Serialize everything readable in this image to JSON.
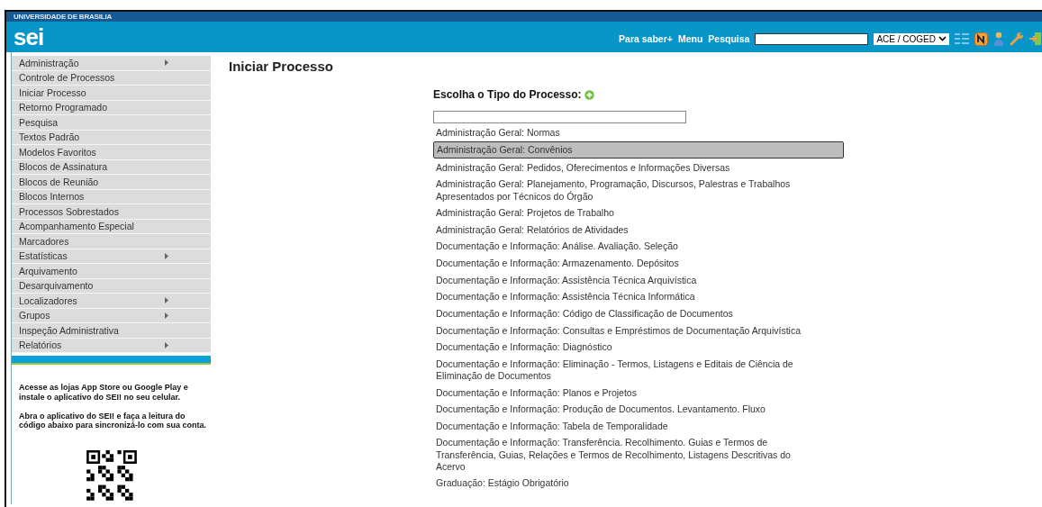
{
  "header": {
    "institution": "UNIVERSIDADE DE BRASILIA",
    "logo": "sei",
    "links": [
      "Para saber+",
      "Menu",
      "Pesquisa"
    ],
    "unit_select": {
      "value": "ACE / COGED"
    }
  },
  "sidebar": {
    "items": [
      {
        "label": "Administração",
        "has_submenu": true
      },
      {
        "label": "Controle de Processos",
        "has_submenu": false
      },
      {
        "label": "Iniciar Processo",
        "has_submenu": false
      },
      {
        "label": "Retorno Programado",
        "has_submenu": false
      },
      {
        "label": "Pesquisa",
        "has_submenu": false
      },
      {
        "label": "Textos Padrão",
        "has_submenu": false
      },
      {
        "label": "Modelos Favoritos",
        "has_submenu": false
      },
      {
        "label": "Blocos de Assinatura",
        "has_submenu": false
      },
      {
        "label": "Blocos de Reunião",
        "has_submenu": false
      },
      {
        "label": "Blocos Internos",
        "has_submenu": false
      },
      {
        "label": "Processos Sobrestados",
        "has_submenu": false
      },
      {
        "label": "Acompanhamento Especial",
        "has_submenu": false
      },
      {
        "label": "Marcadores",
        "has_submenu": false
      },
      {
        "label": "Estatísticas",
        "has_submenu": true
      },
      {
        "label": "Arquivamento",
        "has_submenu": false
      },
      {
        "label": "Desarquivamento",
        "has_submenu": false
      },
      {
        "label": "Localizadores",
        "has_submenu": true
      },
      {
        "label": "Grupos",
        "has_submenu": true
      },
      {
        "label": "Inspeção Administrativa",
        "has_submenu": false
      },
      {
        "label": "Relatórios",
        "has_submenu": true
      }
    ],
    "app_notes": [
      "Acesse as lojas App Store ou Google Play e instale o aplicativo do SEI! no seu celular.",
      "Abra o aplicativo do SEI! e faça a leitura do código abaixo para sincronizá-lo com sua conta."
    ]
  },
  "page": {
    "title": "Iniciar Processo",
    "prompt": "Escolha o Tipo do Processo:",
    "process_types": [
      {
        "label": "Administração Geral: Normas",
        "selected": false
      },
      {
        "label": "Administração Geral: Convênios",
        "selected": true
      },
      {
        "label": "Administração Geral: Pedidos, Oferecimentos e Informações Diversas",
        "selected": false
      },
      {
        "label": "Administração Geral: Planejamento, Programação, Discursos, Palestras e Trabalhos Apresentados por Técnicos do Órgão",
        "selected": false
      },
      {
        "label": "Administração Geral: Projetos de Trabalho",
        "selected": false
      },
      {
        "label": "Administração Geral: Relatórios de Atividades",
        "selected": false
      },
      {
        "label": "Documentação e Informação: Análise. Avaliação. Seleção",
        "selected": false
      },
      {
        "label": "Documentação e Informação: Armazenamento. Depósitos",
        "selected": false
      },
      {
        "label": "Documentação e Informação: Assistência Técnica Arquivística",
        "selected": false
      },
      {
        "label": "Documentação e Informação: Assistência Técnica Informática",
        "selected": false
      },
      {
        "label": "Documentação e Informação: Código de Classificação de Documentos",
        "selected": false
      },
      {
        "label": "Documentação e Informação: Consultas e Empréstimos de Documentação Arquivística",
        "selected": false
      },
      {
        "label": "Documentação e Informação: Diagnóstico",
        "selected": false
      },
      {
        "label": "Documentação e Informação: Eliminação - Termos, Listagens e Editais de Ciência de Eliminação de Documentos",
        "selected": false
      },
      {
        "label": "Documentação e Informação: Planos e Projetos",
        "selected": false
      },
      {
        "label": "Documentação e Informação: Produção de Documentos. Levantamento. Fluxo",
        "selected": false
      },
      {
        "label": "Documentação e Informação: Tabela de Temporalidade",
        "selected": false
      },
      {
        "label": "Documentação e Informação: Transferência. Recolhimento. Guias e Termos de Transferência, Guias, Relações e Termos de Recolhimento, Listagens Descritivas do Acervo",
        "selected": false
      },
      {
        "label": "Graduação: Estágio Obrigatório",
        "selected": false
      }
    ]
  }
}
